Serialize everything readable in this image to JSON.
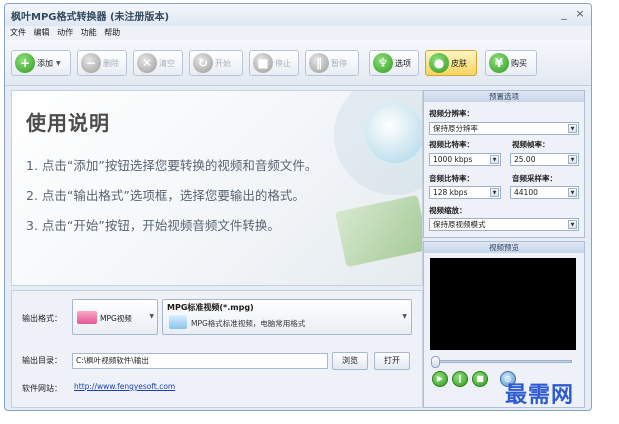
{
  "window": {
    "title": "枫叶MPG格式转换器  (未注册版本)",
    "minimize": "_",
    "close": "×"
  },
  "menu": [
    "文件",
    "编辑",
    "动作",
    "功能",
    "帮助"
  ],
  "toolbar": [
    {
      "label": "添加",
      "icon": "add-icon",
      "state": "enabled",
      "has_dropdown": true
    },
    {
      "label": "删除",
      "icon": "remove-icon",
      "state": "disabled"
    },
    {
      "label": "清空",
      "icon": "clear-icon",
      "state": "disabled"
    },
    {
      "label": "开始",
      "icon": "start-icon",
      "state": "disabled"
    },
    {
      "label": "停止",
      "icon": "stop-icon",
      "state": "disabled"
    },
    {
      "label": "暂停",
      "icon": "pause-icon",
      "state": "disabled"
    },
    {
      "label": "选项",
      "icon": "options-icon",
      "state": "enabled"
    },
    {
      "label": "皮肤",
      "icon": "skin-icon",
      "state": "enabled"
    },
    {
      "label": "购买",
      "icon": "buy-icon",
      "state": "enabled"
    }
  ],
  "instructions": {
    "heading": "使用说明",
    "steps": [
      "1. 点击“添加”按钮选择您要转换的视频和音频文件。",
      "2. 点击“输出格式”选项框，选择您要输出的格式。",
      "3. 点击“开始”按钮，开始视频音频文件转换。"
    ]
  },
  "presets": {
    "header": "预置选项",
    "video_resolution": {
      "label": "视频分辨率：",
      "value": "保持原分辨率"
    },
    "video_bitrate": {
      "label": "视频比特率：",
      "value": "1000 kbps"
    },
    "video_framerate": {
      "label": "视频帧率：",
      "value": "25.00"
    },
    "audio_bitrate": {
      "label": "音频比特率：",
      "value": "128 kbps"
    },
    "audio_samplerate": {
      "label": "音频采样率：",
      "value": "44100"
    },
    "video_scale": {
      "label": "视频缩放：",
      "value": "保持原视频模式"
    }
  },
  "preview": {
    "header": "视频预览"
  },
  "output": {
    "format_label": "输出格式：",
    "category": "MPG视频",
    "format_title": "MPG标准视频(*.mpg)",
    "format_desc": "MPG格式标准视频，电脑常用格式",
    "dir_label": "输出目录：",
    "dir_value": "C:\\枫叶视频软件\\输出",
    "browse_button": "浏览",
    "open_button": "打开",
    "website_label": "软件网站：",
    "website_url": "http://www.fengyesoft.com"
  },
  "watermark": "最需网",
  "colors": {
    "accent_green": "#2f9a1f",
    "skin_button": "#f5d35e",
    "link": "#1a3fae"
  }
}
